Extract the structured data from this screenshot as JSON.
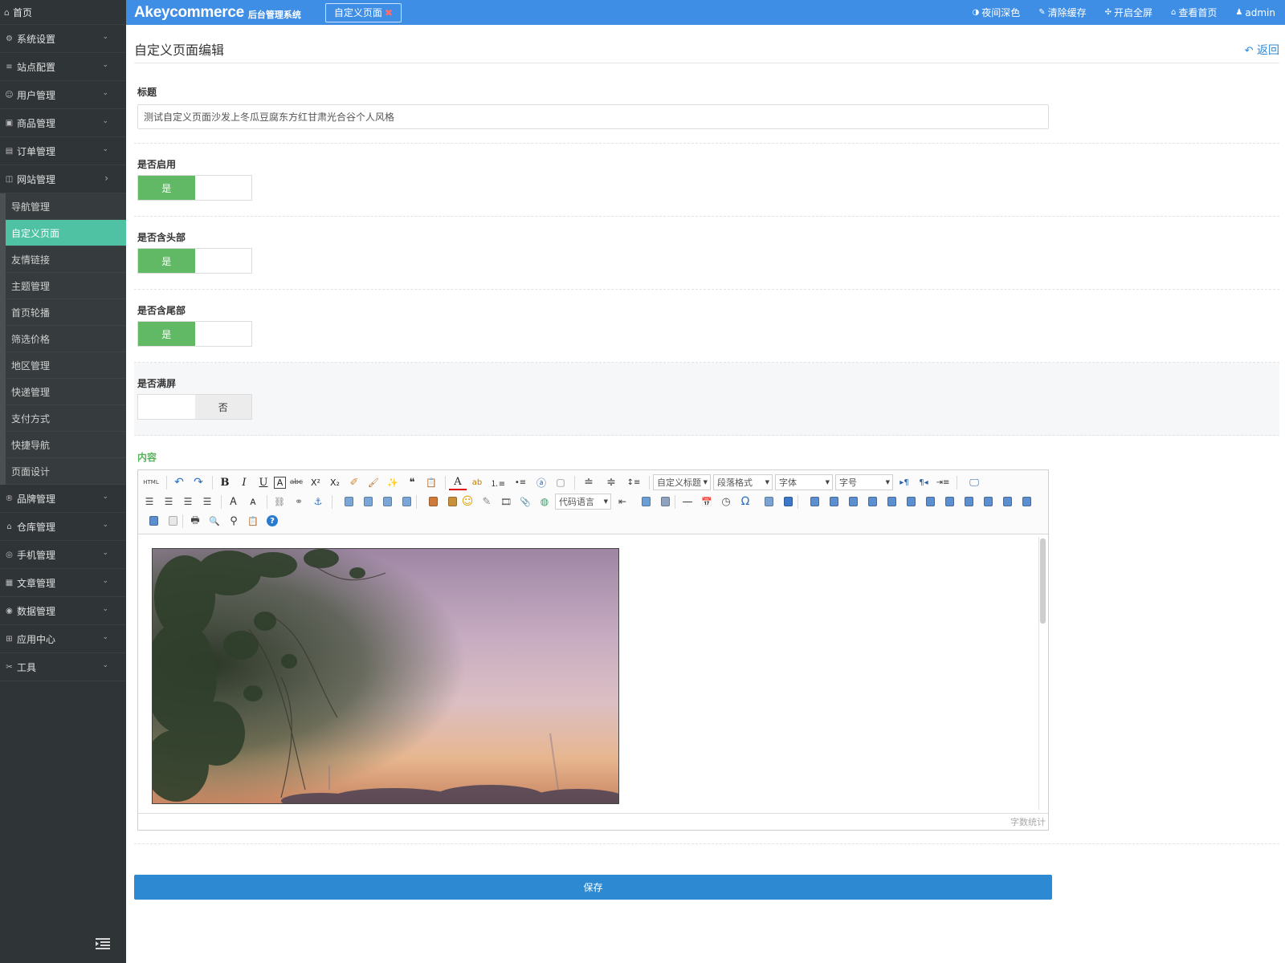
{
  "sidebar": {
    "home": {
      "icon": "home-icon",
      "label": "首页"
    },
    "groups_top": [
      {
        "icon": "gear-icon",
        "label": "系统设置"
      },
      {
        "icon": "sliders-icon",
        "label": "站点配置"
      },
      {
        "icon": "user-icon",
        "label": "用户管理"
      },
      {
        "icon": "box-icon",
        "label": "商品管理"
      },
      {
        "icon": "order-icon",
        "label": "订单管理"
      },
      {
        "icon": "website-icon",
        "label": "网站管理"
      }
    ],
    "subitems": [
      {
        "label": "导航管理",
        "active": false
      },
      {
        "label": "自定义页面",
        "active": true
      },
      {
        "label": "友情链接",
        "active": false
      },
      {
        "label": "主题管理",
        "active": false
      },
      {
        "label": "首页轮播",
        "active": false
      },
      {
        "label": "筛选价格",
        "active": false
      },
      {
        "label": "地区管理",
        "active": false
      },
      {
        "label": "快递管理",
        "active": false
      },
      {
        "label": "支付方式",
        "active": false
      },
      {
        "label": "快捷导航",
        "active": false
      },
      {
        "label": "页面设计",
        "active": false
      }
    ],
    "groups_bottom": [
      {
        "icon": "brand-icon",
        "label": "品牌管理"
      },
      {
        "icon": "warehouse-icon",
        "label": "仓库管理"
      },
      {
        "icon": "mobile-icon",
        "label": "手机管理"
      },
      {
        "icon": "article-icon",
        "label": "文章管理"
      },
      {
        "icon": "database-icon",
        "label": "数据管理"
      },
      {
        "icon": "apps-icon",
        "label": "应用中心"
      },
      {
        "icon": "tools-icon",
        "label": "工具"
      }
    ],
    "colors": {
      "bg": "#2f3437",
      "active": "#4ec2a3"
    }
  },
  "topbar": {
    "brand": "Akeycommerce",
    "brand_sub": "后台管理系统",
    "open_tab": "自定义页面",
    "tools": [
      {
        "icon": "contrast-icon",
        "label": "夜间深色"
      },
      {
        "icon": "brush-icon",
        "label": "清除缓存"
      },
      {
        "icon": "fullscreen-icon",
        "label": "开启全屏"
      },
      {
        "icon": "home-icon",
        "label": "查看首页"
      },
      {
        "icon": "user-icon",
        "label": "admin"
      }
    ],
    "color": "#3e8ee6"
  },
  "page": {
    "title": "自定义页面编辑",
    "back_label": "返回"
  },
  "form": {
    "title_label": "标题",
    "title_value": "测试自定义页面沙发上冬瓜豆腐东方红甘肃光合谷个人风格",
    "enabled_label": "是否启用",
    "enabled_value": "是",
    "header_label": "是否含头部",
    "header_value": "是",
    "footer_label": "是否含尾部",
    "footer_value": "是",
    "fullscreen_label": "是否满屏",
    "fullscreen_value": "否",
    "content_label": "内容",
    "save_label": "保存"
  },
  "editor": {
    "selects": {
      "code_lang": "代码语言",
      "custom_title": "自定义标题",
      "paragraph": "段落格式",
      "font": "字体",
      "size": "字号"
    },
    "html_label": "HTML",
    "word_count_label": "字数统计"
  }
}
